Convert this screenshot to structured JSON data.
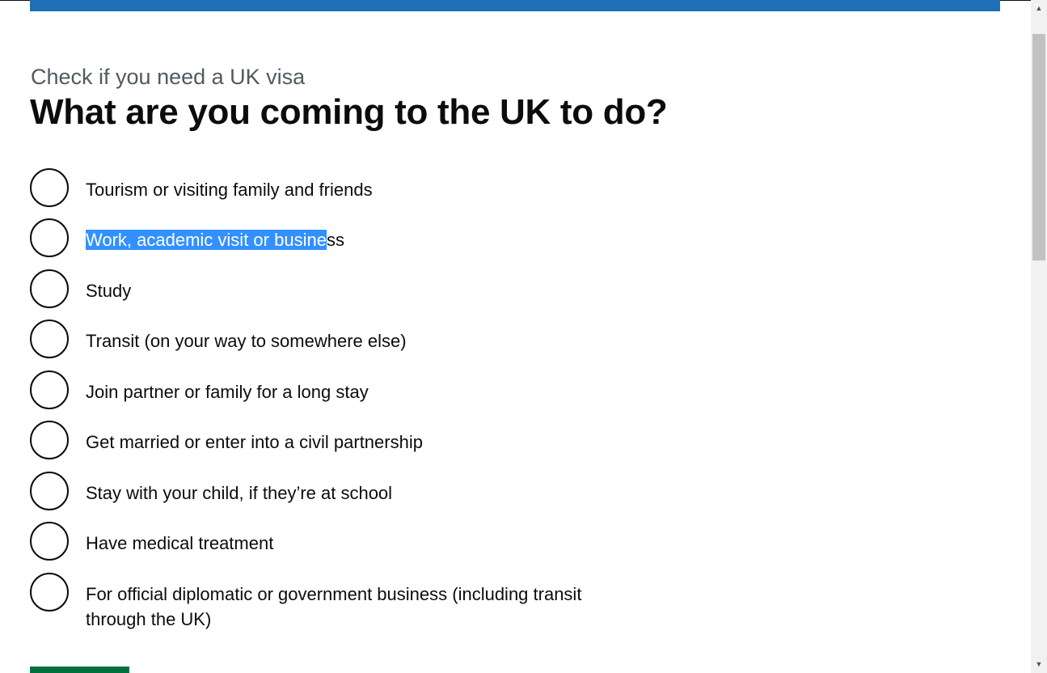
{
  "header": {
    "caption": "Check if you need a UK visa",
    "title": "What are you coming to the UK to do?",
    "bar_color": "#1d70b8"
  },
  "options": [
    {
      "label": "Tourism or visiting family and friends"
    },
    {
      "label_selected": "Work, academic visit or busine",
      "label_rest": "ss"
    },
    {
      "label": "Study"
    },
    {
      "label": "Transit (on your way to somewhere else)"
    },
    {
      "label": "Join partner or family for a long stay"
    },
    {
      "label": "Get married or enter into a civil partnership"
    },
    {
      "label": "Stay with your child, if they’re at school"
    },
    {
      "label": "Have medical treatment"
    },
    {
      "label": "For official diplomatic or government business (including transit through the UK)"
    }
  ],
  "submit": {
    "color": "#00703c"
  },
  "scrollbar": {
    "up_icon": "triangle-up-icon",
    "down_icon": "triangle-down-icon"
  }
}
